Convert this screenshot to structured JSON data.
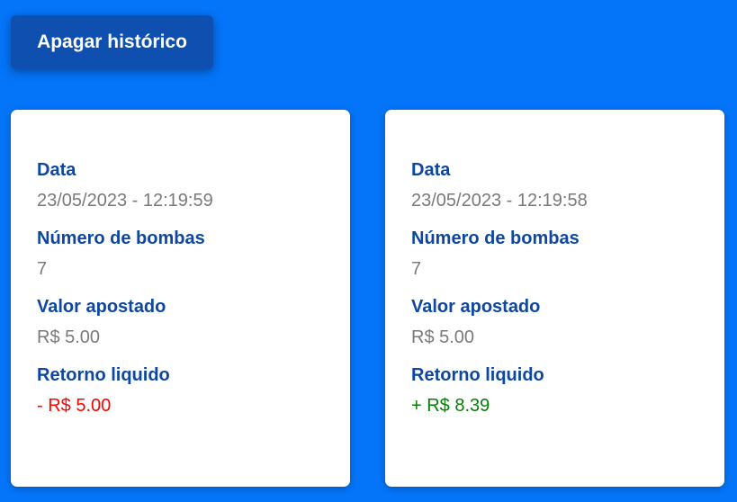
{
  "toolbar": {
    "clear_history_label": "Apagar histórico"
  },
  "labels": {
    "date": "Data",
    "bombs": "Número de bombas",
    "bet": "Valor apostado",
    "net_return": "Retorno liquido"
  },
  "colors": {
    "background": "#0474f8",
    "button": "#0f4fb0",
    "label": "#0d47a1",
    "value": "#7a7a7a",
    "loss": "#ff0000",
    "gain": "#067e06"
  },
  "history": [
    {
      "date": "23/05/2023 - 12:19:59",
      "bombs": "7",
      "bet": "R$ 5.00",
      "net_return": "- R$ 5.00",
      "result": "loss"
    },
    {
      "date": "23/05/2023 - 12:19:58",
      "bombs": "7",
      "bet": "R$ 5.00",
      "net_return": "+ R$ 8.39",
      "result": "gain"
    }
  ]
}
